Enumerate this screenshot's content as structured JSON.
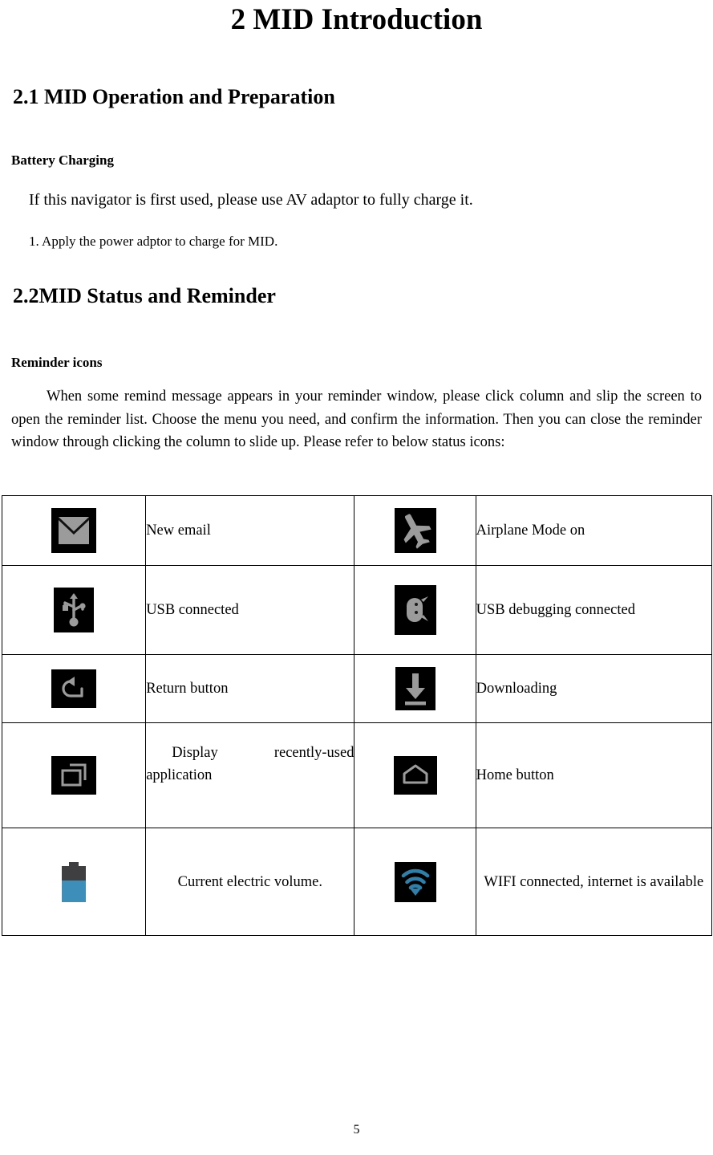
{
  "document": {
    "title": "2 MID Introduction",
    "page_number": "5"
  },
  "sections": {
    "s21": {
      "heading": "2.1 MID Operation and Preparation",
      "subheading": "Battery Charging",
      "line1": "If this navigator is first used, please use AV adaptor to fully charge it.",
      "line2": "1. Apply the power adptor to charge for MID."
    },
    "s22": {
      "heading": "2.2MID Status and Reminder",
      "subheading": "Reminder icons",
      "paragraph": "When some remind message appears in your reminder window, please click column and slip the screen to open the reminder list. Choose the menu you need, and confirm the information. Then you can close the reminder window through clicking the column to slide up. Please refer to below status icons:"
    }
  },
  "status_icons_table": {
    "rows": [
      {
        "left_icon": "new-email-icon",
        "left_label": "New email",
        "right_icon": "airplane-mode-icon",
        "right_label": "Airplane Mode on"
      },
      {
        "left_icon": "usb-connected-icon",
        "left_label": "USB connected",
        "right_icon": "usb-debugging-icon",
        "right_label": "USB debugging connected"
      },
      {
        "left_icon": "return-button-icon",
        "left_label": "Return button",
        "right_icon": "downloading-icon",
        "right_label": "Downloading"
      },
      {
        "left_icon": "recent-apps-icon",
        "left_label": "Display recently-used application",
        "right_icon": "home-button-icon",
        "right_label": "Home button"
      },
      {
        "left_icon": "battery-icon",
        "left_label": "Current electric volume.",
        "right_icon": "wifi-connected-icon",
        "right_label": "WIFI connected, internet is available"
      }
    ]
  },
  "colors": {
    "icon_tile_background": "#000000",
    "icon_glyph_gray": "#9b9b9b",
    "battery_body": "#3f3f41",
    "battery_fill": "#3d8fb9",
    "wifi_blue": "#2f7fa8",
    "text": "#000000",
    "page_background": "#ffffff"
  }
}
